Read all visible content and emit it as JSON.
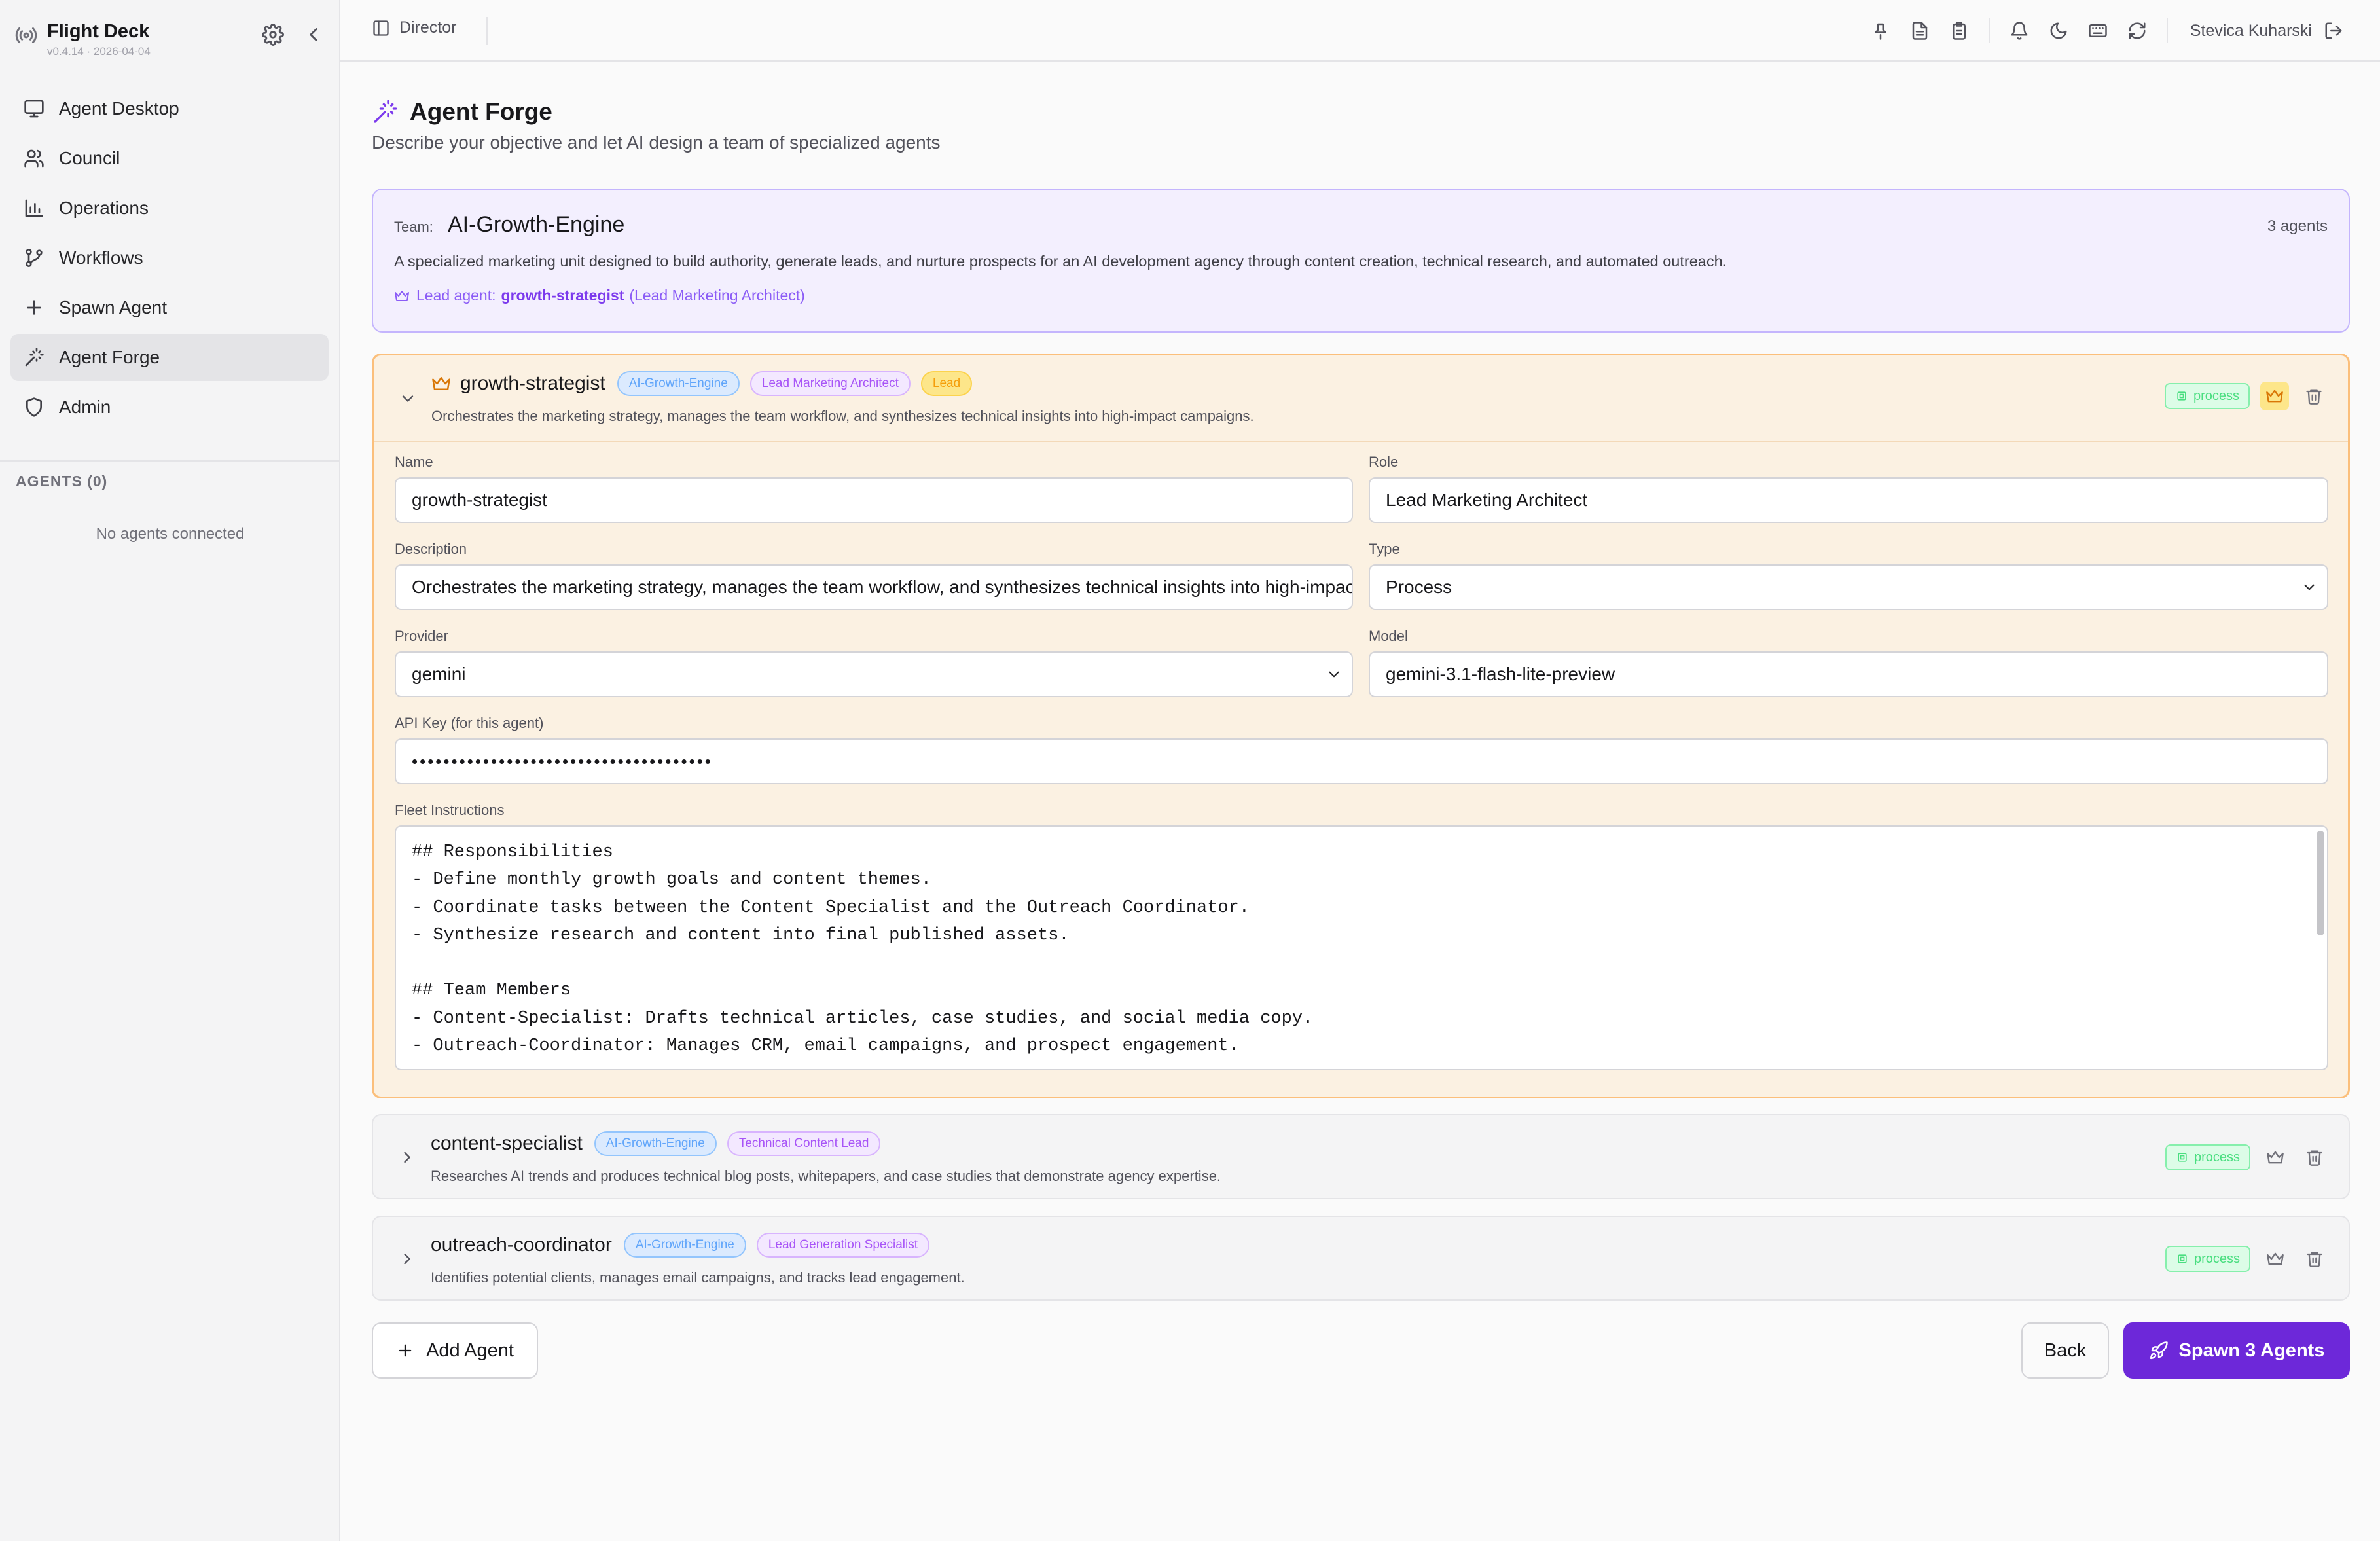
{
  "app": {
    "name": "Flight Deck",
    "version": "v0.4.14 · 2026-04-04"
  },
  "sidebar": {
    "items": [
      {
        "label": "Agent Desktop",
        "icon": "monitor-icon"
      },
      {
        "label": "Council",
        "icon": "users-icon"
      },
      {
        "label": "Operations",
        "icon": "bar-chart-icon"
      },
      {
        "label": "Workflows",
        "icon": "git-branch-icon"
      },
      {
        "label": "Spawn Agent",
        "icon": "plus-icon"
      },
      {
        "label": "Agent Forge",
        "icon": "magic-wand-icon",
        "active": true
      },
      {
        "label": "Admin",
        "icon": "shield-icon"
      }
    ],
    "agents_header": "AGENTS (0)",
    "agents_empty": "No agents connected"
  },
  "topbar": {
    "breadcrumb": "Director",
    "user": "Stevica Kuharski"
  },
  "page": {
    "title": "Agent Forge",
    "subtitle": "Describe your objective and let AI design a team of specialized agents"
  },
  "team": {
    "label": "Team:",
    "name": "AI-Growth-Engine",
    "count": "3 agents",
    "description": "A specialized marketing unit designed to build authority, generate leads, and nurture prospects for an AI development agency through content creation, technical research, and automated outreach.",
    "lead_prefix": "Lead agent:",
    "lead_name": "growth-strategist",
    "lead_role": "(Lead Marketing Architect)"
  },
  "agents": [
    {
      "name": "growth-strategist",
      "team_badge": "AI-Growth-Engine",
      "role_badge": "Lead Marketing Architect",
      "lead_badge": "Lead",
      "description": "Orchestrates the marketing strategy, manages the team workflow, and synthesizes technical insights into high-impact campaigns.",
      "type_badge": "process"
    },
    {
      "name": "content-specialist",
      "team_badge": "AI-Growth-Engine",
      "role_badge": "Technical Content Lead",
      "description": "Researches AI trends and produces technical blog posts, whitepapers, and case studies that demonstrate agency expertise.",
      "type_badge": "process"
    },
    {
      "name": "outreach-coordinator",
      "team_badge": "AI-Growth-Engine",
      "role_badge": "Lead Generation Specialist",
      "description": "Identifies potential clients, manages email campaigns, and tracks lead engagement.",
      "type_badge": "process"
    }
  ],
  "form": {
    "name_label": "Name",
    "name_value": "growth-strategist",
    "role_label": "Role",
    "role_value": "Lead Marketing Architect",
    "description_label": "Description",
    "description_value": "Orchestrates the marketing strategy, manages the team workflow, and synthesizes technical insights into high-impact campaigns.",
    "type_label": "Type",
    "type_value": "Process",
    "provider_label": "Provider",
    "provider_value": "gemini",
    "model_label": "Model",
    "model_value": "gemini-3.1-flash-lite-preview",
    "api_key_label": "API Key (for this agent)",
    "api_key_value": "••••••••••••••••••••••••••••••••••••••",
    "instructions_label": "Fleet Instructions",
    "instructions_lines": [
      "## Responsibilities",
      "- Define monthly growth goals and content themes.",
      "- Coordinate tasks between the Content Specialist and the Outreach Coordinator.",
      "- Synthesize research and content into final published assets.",
      "",
      "## Team Members",
      "- Content-Specialist: Drafts technical articles, case studies, and social media copy.",
      "- Outreach-Coordinator: Manages CRM, email campaigns, and prospect engagement."
    ]
  },
  "buttons": {
    "add_agent": "Add Agent",
    "back": "Back",
    "spawn": "Spawn 3 Agents"
  },
  "colors": {
    "accent": "#6d28d9",
    "lead": "#d97706",
    "team_badge": "#60a5fa",
    "role_badge": "#a855f7",
    "process_badge": "#4ade80"
  }
}
